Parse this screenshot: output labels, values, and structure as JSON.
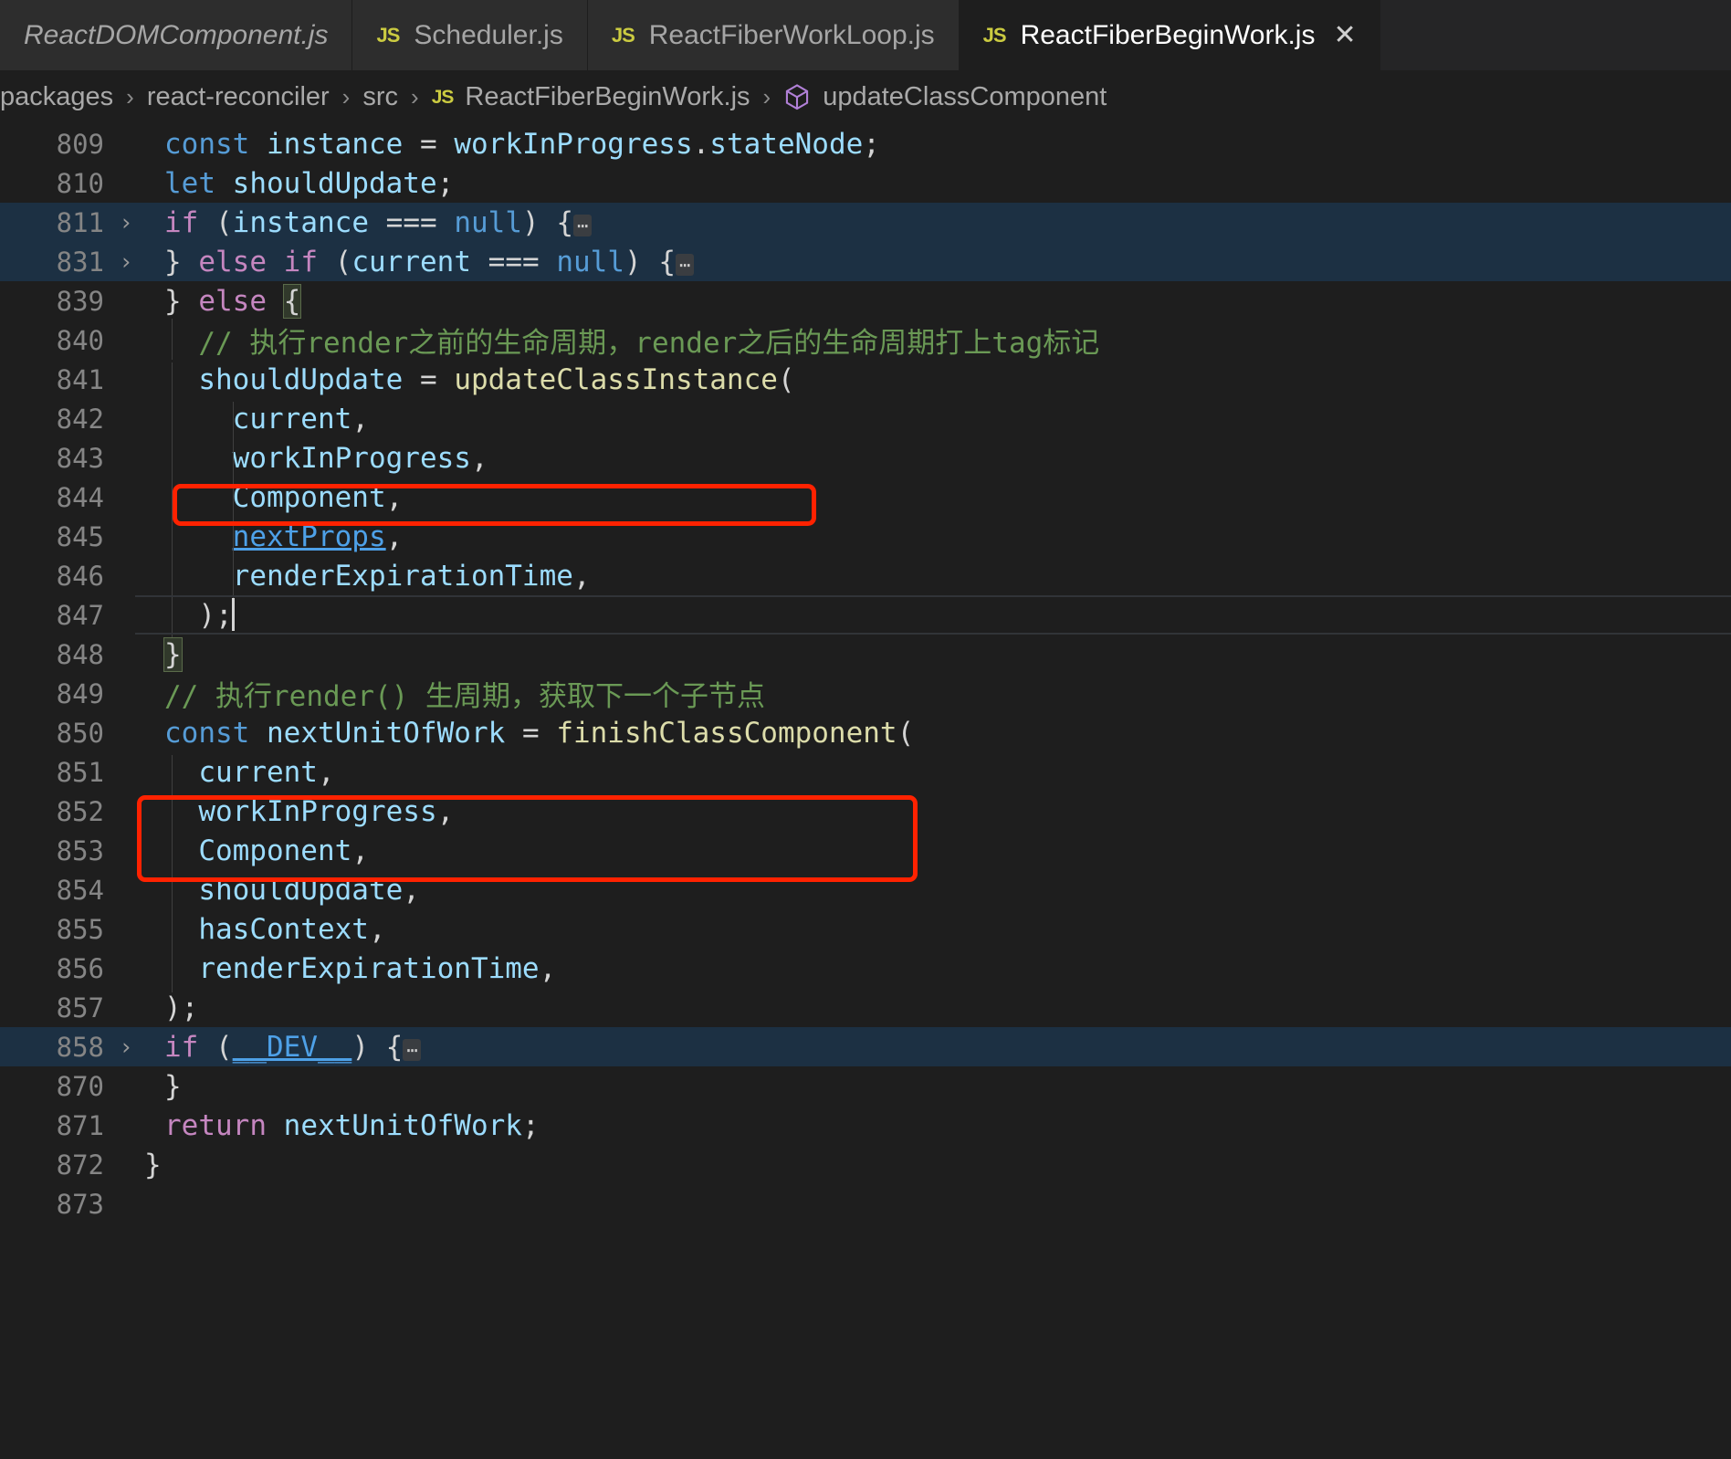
{
  "window": {
    "app": "Visual Studio Code",
    "theme_bg": "#1e1e1e",
    "accent_annotation": "#ff2200"
  },
  "tabbar": {
    "tabs": [
      {
        "label": "ReactDOMComponent.js",
        "icon": "",
        "active": false,
        "preview": true
      },
      {
        "label": "Scheduler.js",
        "icon": "JS",
        "active": false,
        "preview": false
      },
      {
        "label": "ReactFiberWorkLoop.js",
        "icon": "JS",
        "active": false,
        "preview": false
      },
      {
        "label": "ReactFiberBeginWork.js",
        "icon": "JS",
        "active": true,
        "preview": false
      }
    ],
    "close_glyph": "✕"
  },
  "breadcrumb": {
    "separator": "›",
    "items": [
      {
        "label": "packages",
        "icon": "none"
      },
      {
        "label": "react-reconciler",
        "icon": "none"
      },
      {
        "label": "src",
        "icon": "none"
      },
      {
        "label": "ReactFiberBeginWork.js",
        "icon": "js-file-icon"
      },
      {
        "label": "updateClassComponent",
        "icon": "symbol-method-cube-icon"
      }
    ]
  },
  "editor": {
    "language": "javascript",
    "fold_chevron": "›",
    "collapsed_marker": "⋯",
    "lines": [
      {
        "n": "809",
        "fold": false,
        "state": "normal",
        "indent": 0
      },
      {
        "n": "810",
        "fold": false,
        "state": "normal",
        "indent": 0
      },
      {
        "n": "811",
        "fold": true,
        "state": "folded",
        "indent": 0
      },
      {
        "n": "831",
        "fold": true,
        "state": "folded",
        "indent": 0
      },
      {
        "n": "839",
        "fold": false,
        "state": "normal",
        "indent": 0
      },
      {
        "n": "840",
        "fold": false,
        "state": "normal",
        "indent": 1
      },
      {
        "n": "841",
        "fold": false,
        "state": "boxed",
        "indent": 1
      },
      {
        "n": "842",
        "fold": false,
        "state": "normal",
        "indent": 2
      },
      {
        "n": "843",
        "fold": false,
        "state": "normal",
        "indent": 2
      },
      {
        "n": "844",
        "fold": false,
        "state": "normal",
        "indent": 2
      },
      {
        "n": "845",
        "fold": false,
        "state": "normal",
        "indent": 2
      },
      {
        "n": "846",
        "fold": false,
        "state": "normal",
        "indent": 2
      },
      {
        "n": "847",
        "fold": false,
        "state": "current",
        "indent": 1
      },
      {
        "n": "848",
        "fold": false,
        "state": "normal",
        "indent": 0
      },
      {
        "n": "849",
        "fold": false,
        "state": "boxed",
        "indent": 0
      },
      {
        "n": "850",
        "fold": false,
        "state": "boxed",
        "indent": 0
      },
      {
        "n": "851",
        "fold": false,
        "state": "normal",
        "indent": 1
      },
      {
        "n": "852",
        "fold": false,
        "state": "normal",
        "indent": 1
      },
      {
        "n": "853",
        "fold": false,
        "state": "normal",
        "indent": 1
      },
      {
        "n": "854",
        "fold": false,
        "state": "normal",
        "indent": 1
      },
      {
        "n": "855",
        "fold": false,
        "state": "normal",
        "indent": 1
      },
      {
        "n": "856",
        "fold": false,
        "state": "normal",
        "indent": 1
      },
      {
        "n": "857",
        "fold": false,
        "state": "normal",
        "indent": 0
      },
      {
        "n": "858",
        "fold": true,
        "state": "folded",
        "indent": 0
      },
      {
        "n": "870",
        "fold": false,
        "state": "normal",
        "indent": 0
      },
      {
        "n": "871",
        "fold": false,
        "state": "normal",
        "indent": 0
      },
      {
        "n": "872",
        "fold": false,
        "state": "normal",
        "indent": 0
      },
      {
        "n": "873",
        "fold": false,
        "state": "normal",
        "indent": 0
      }
    ],
    "source": {
      "l809": "const instance = workInProgress.stateNode;",
      "l810": "let shouldUpdate;",
      "l811": "if (instance === null) {",
      "l831": "} else if (current === null) {",
      "l839": "} else {",
      "l840": "// 执行render之前的生命周期，render之后的生命周期打上tag标记",
      "l841": "shouldUpdate = updateClassInstance(",
      "l842": "current,",
      "l843": "workInProgress,",
      "l844": "Component,",
      "l845": "nextProps,",
      "l846": "renderExpirationTime,",
      "l847": ");",
      "l848": "}",
      "l849": "// 执行render() 生周期，获取下一个子节点",
      "l850": "const nextUnitOfWork = finishClassComponent(",
      "l851": "current,",
      "l852": "workInProgress,",
      "l853": "Component,",
      "l854": "shouldUpdate,",
      "l855": "hasContext,",
      "l856": "renderExpirationTime,",
      "l857": ");",
      "l858": "if (__DEV__) {",
      "l870": "}",
      "l871": "return nextUnitOfWork;",
      "l872": "}",
      "l873": ""
    },
    "tokens": {
      "const": "const",
      "let": "let",
      "if": "if",
      "else": "else",
      "return": "return",
      "instance": "instance",
      "workInProgress": "workInProgress",
      "stateNode": "stateNode",
      "shouldUpdate": "shouldUpdate",
      "null": "null",
      "current": "current",
      "Component": "Component",
      "nextProps": "nextProps",
      "renderExpirationTime": "renderExpirationTime",
      "hasContext": "hasContext",
      "nextUnitOfWork": "nextUnitOfWork",
      "updateClassInstance": "updateClassInstance",
      "finishClassComponent": "finishClassComponent",
      "dev": "__DEV__",
      "eq": "===",
      "assign": "=",
      "comma": ",",
      "semi": ";",
      "dot": ".",
      "lparen": "(",
      "rparen": ")",
      "lbrace": "{",
      "rbrace": "}",
      "rparen_semi": ");",
      "slashes": "// "
    },
    "comments": {
      "c840": "执行render之前的生命周期，render之后的生命周期打上tag标记",
      "c849": "执行render() 生周期，获取下一个子节点"
    }
  }
}
